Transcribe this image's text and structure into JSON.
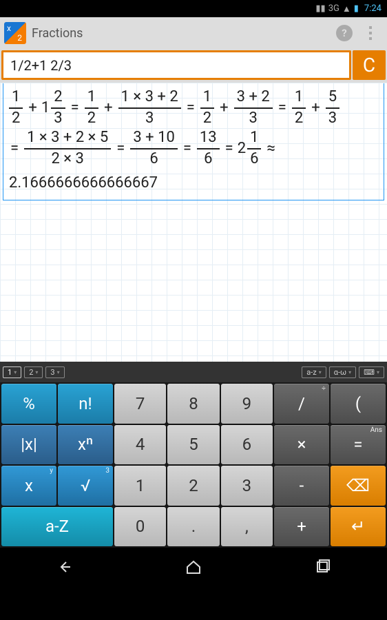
{
  "status": {
    "net": "3G",
    "time": "7:24"
  },
  "header": {
    "title": "Fractions"
  },
  "input": {
    "expression": "1/2+1 2/3",
    "clear": "C"
  },
  "result": {
    "decimal": "2.1666666666666667"
  },
  "tabs": {
    "t1": "1",
    "t2": "2",
    "t3": "3",
    "az": "a-z",
    "gw": "α-ω"
  },
  "keys": {
    "pct": "%",
    "nf": "n!",
    "k7": "7",
    "k8": "8",
    "k9": "9",
    "div": "/",
    "lp": "(",
    "abs": "|x|",
    "xn": "xⁿ",
    "k4": "4",
    "k5": "5",
    "k6": "6",
    "mul": "×",
    "rp": ")",
    "x": "x",
    "sqrt": "√",
    "k1": "1",
    "k2": "2",
    "k3": "3",
    "sub": "-",
    "aZ": "a-Z",
    "k0": "0",
    "dot": ".",
    "com": ",",
    "add": "+",
    "eq": "=",
    "bs": "⌫",
    "ent": "↵",
    "sup_div": "÷",
    "sup_y": "y",
    "sup_3": "3",
    "sup_ans": "Ans"
  }
}
